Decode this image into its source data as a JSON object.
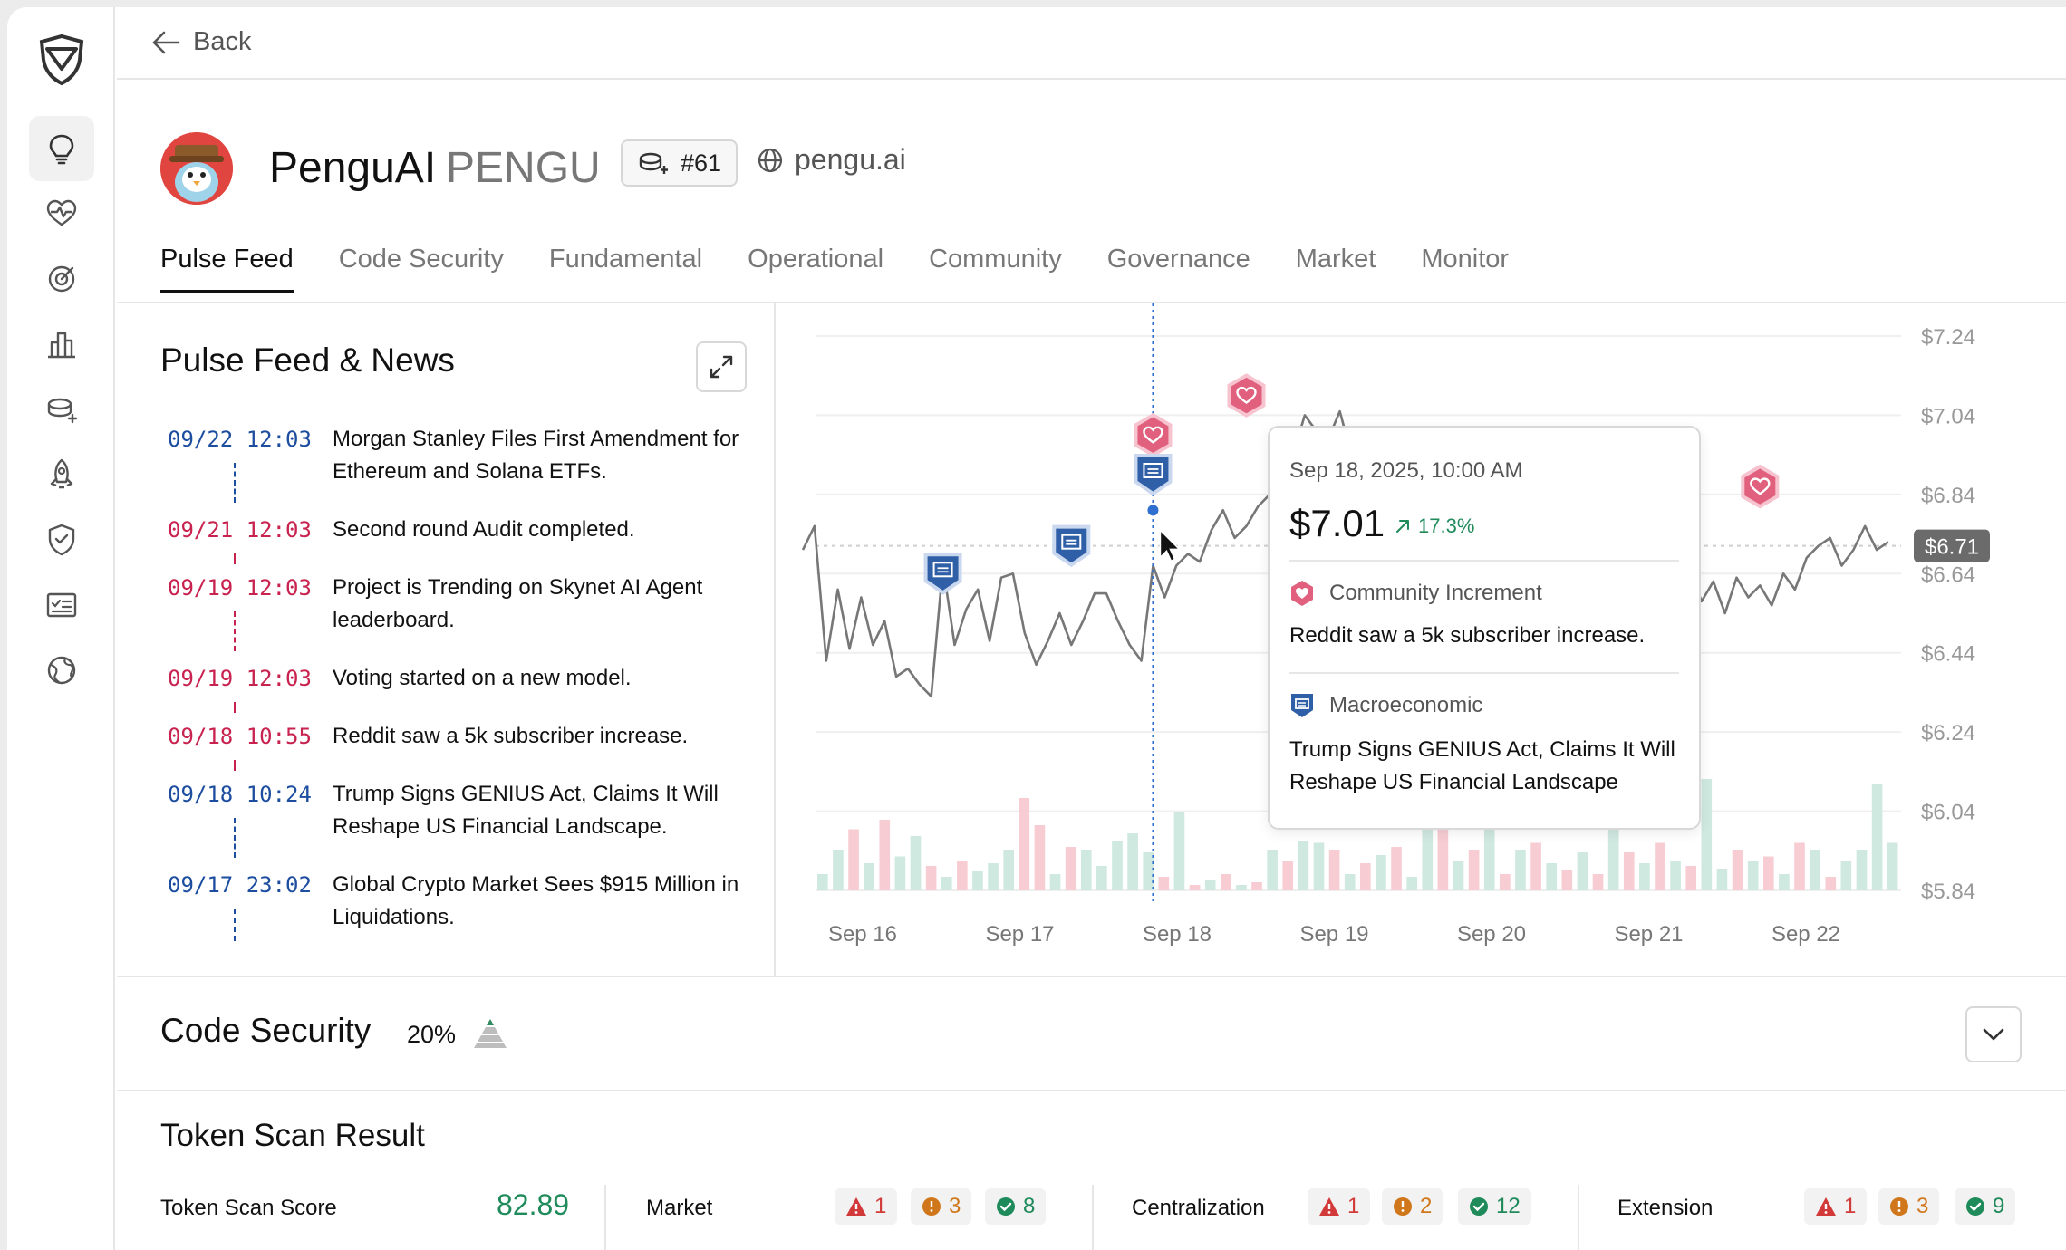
{
  "topbar": {
    "back_label": "Back"
  },
  "project": {
    "name": "PenguAI",
    "ticker": "PENGU",
    "rank": "#61",
    "website": "pengu.ai"
  },
  "tabs": [
    {
      "label": "Pulse Feed",
      "active": true
    },
    {
      "label": "Code Security"
    },
    {
      "label": "Fundamental"
    },
    {
      "label": "Operational"
    },
    {
      "label": "Community"
    },
    {
      "label": "Governance"
    },
    {
      "label": "Market"
    },
    {
      "label": "Monitor"
    }
  ],
  "feed": {
    "title": "Pulse Feed & News",
    "items": [
      {
        "time": "09/22 12:03",
        "text": "Morgan Stanley Files First Amendment for Ethereum and Solana ETFs.",
        "tone": "blue"
      },
      {
        "time": "09/21 12:03",
        "text": "Second round Audit completed.",
        "tone": "red"
      },
      {
        "time": "09/19 12:03",
        "text": "Project is Trending on Skynet AI Agent leaderboard.",
        "tone": "red"
      },
      {
        "time": "09/19 12:03",
        "text": "Voting started on a new model.",
        "tone": "red"
      },
      {
        "time": "09/18 10:55",
        "text": "Reddit saw a 5k subscriber increase.",
        "tone": "red"
      },
      {
        "time": "09/18 10:24",
        "text": "Trump Signs GENIUS Act, Claims It Will Reshape US Financial Landscape.",
        "tone": "blue"
      },
      {
        "time": "09/17 23:02",
        "text": "Global Crypto Market Sees $915 Million in Liquidations.",
        "tone": "blue"
      }
    ]
  },
  "chart_data": {
    "type": "line",
    "x_ticks": [
      "Sep 16",
      "Sep 17",
      "Sep 18",
      "Sep 19",
      "Sep 20",
      "Sep 21",
      "Sep 22"
    ],
    "y_ticks": [
      "$7.24",
      "$7.04",
      "$6.84",
      "$6.64",
      "$6.44",
      "$6.24",
      "$6.04",
      "$5.84"
    ],
    "ylim": [
      5.84,
      7.24
    ],
    "current_price_label": "$6.71",
    "current_price": 6.71,
    "series": [
      {
        "values": [
          6.7,
          6.76,
          6.42,
          6.6,
          6.45,
          6.58,
          6.46,
          6.52,
          6.38,
          6.4,
          6.36,
          6.33,
          6.66,
          6.46,
          6.55,
          6.6,
          6.47,
          6.63,
          6.64,
          6.49,
          6.41,
          6.47,
          6.54,
          6.46,
          6.52,
          6.59,
          6.59,
          6.52,
          6.46,
          6.42,
          6.66,
          6.58,
          6.66,
          6.69,
          6.67,
          6.75,
          6.8,
          6.73,
          6.76,
          6.81,
          6.84,
          6.9,
          6.94,
          7.04,
          7.0,
          6.98,
          7.05,
          6.94,
          6.9,
          6.85,
          6.81,
          6.79,
          6.78,
          6.73,
          6.66,
          6.69,
          6.63,
          6.68,
          6.61,
          6.64,
          6.56,
          6.66,
          6.7,
          6.64,
          6.66,
          6.74,
          6.7,
          6.68,
          6.61,
          6.67,
          6.74,
          6.66,
          6.72,
          6.68,
          6.67,
          6.62,
          6.65,
          6.57,
          6.62,
          6.54,
          6.63,
          6.58,
          6.61,
          6.56,
          6.64,
          6.6,
          6.68,
          6.71,
          6.73,
          6.66,
          6.7,
          6.76,
          6.7,
          6.72
        ]
      }
    ],
    "volume": [
      {
        "v": 0.12,
        "up": true
      },
      {
        "v": 0.3,
        "up": true
      },
      {
        "v": 0.45,
        "up": false
      },
      {
        "v": 0.2,
        "up": true
      },
      {
        "v": 0.52,
        "up": false
      },
      {
        "v": 0.25,
        "up": true
      },
      {
        "v": 0.4,
        "up": true
      },
      {
        "v": 0.18,
        "up": false
      },
      {
        "v": 0.1,
        "up": true
      },
      {
        "v": 0.22,
        "up": false
      },
      {
        "v": 0.14,
        "up": true
      },
      {
        "v": 0.2,
        "up": true
      },
      {
        "v": 0.3,
        "up": true
      },
      {
        "v": 0.68,
        "up": false
      },
      {
        "v": 0.48,
        "up": false
      },
      {
        "v": 0.12,
        "up": true
      },
      {
        "v": 0.32,
        "up": false
      },
      {
        "v": 0.3,
        "up": true
      },
      {
        "v": 0.18,
        "up": true
      },
      {
        "v": 0.36,
        "up": true
      },
      {
        "v": 0.42,
        "up": true
      },
      {
        "v": 0.28,
        "up": true
      },
      {
        "v": 0.1,
        "up": false
      },
      {
        "v": 0.58,
        "up": true
      },
      {
        "v": 0.04,
        "up": false
      },
      {
        "v": 0.08,
        "up": true
      },
      {
        "v": 0.12,
        "up": false
      },
      {
        "v": 0.04,
        "up": true
      },
      {
        "v": 0.06,
        "up": false
      },
      {
        "v": 0.3,
        "up": true
      },
      {
        "v": 0.22,
        "up": false
      },
      {
        "v": 0.36,
        "up": true
      },
      {
        "v": 0.35,
        "up": true
      },
      {
        "v": 0.3,
        "up": false
      },
      {
        "v": 0.12,
        "up": true
      },
      {
        "v": 0.2,
        "up": false
      },
      {
        "v": 0.26,
        "up": true
      },
      {
        "v": 0.32,
        "up": false
      },
      {
        "v": 0.1,
        "up": true
      },
      {
        "v": 0.6,
        "up": true
      },
      {
        "v": 0.45,
        "up": false
      },
      {
        "v": 0.22,
        "up": true
      },
      {
        "v": 0.3,
        "up": false
      },
      {
        "v": 0.55,
        "up": true
      },
      {
        "v": 0.12,
        "up": false
      },
      {
        "v": 0.3,
        "up": true
      },
      {
        "v": 0.35,
        "up": false
      },
      {
        "v": 0.2,
        "up": true
      },
      {
        "v": 0.15,
        "up": false
      },
      {
        "v": 0.28,
        "up": true
      },
      {
        "v": 0.12,
        "up": false
      },
      {
        "v": 0.45,
        "up": true
      },
      {
        "v": 0.28,
        "up": false
      },
      {
        "v": 0.2,
        "up": true
      },
      {
        "v": 0.35,
        "up": false
      },
      {
        "v": 0.22,
        "up": true
      },
      {
        "v": 0.18,
        "up": false
      },
      {
        "v": 0.82,
        "up": true
      },
      {
        "v": 0.16,
        "up": true
      },
      {
        "v": 0.3,
        "up": false
      },
      {
        "v": 0.22,
        "up": true
      },
      {
        "v": 0.25,
        "up": false
      },
      {
        "v": 0.12,
        "up": true
      },
      {
        "v": 0.35,
        "up": false
      },
      {
        "v": 0.3,
        "up": true
      },
      {
        "v": 0.1,
        "up": false
      },
      {
        "v": 0.22,
        "up": true
      },
      {
        "v": 0.3,
        "up": true
      },
      {
        "v": 0.78,
        "up": true
      },
      {
        "v": 0.35,
        "up": true
      }
    ],
    "events": [
      {
        "kind": "news",
        "x_index": 12,
        "y": 6.64
      },
      {
        "kind": "news",
        "x_index": 23,
        "y": 6.71
      },
      {
        "kind": "community",
        "x_index": 30,
        "y": 6.99
      },
      {
        "kind": "news",
        "x_index": 30,
        "y": 6.89
      },
      {
        "kind": "community",
        "x_index": 38,
        "y": 7.09
      },
      {
        "kind": "news",
        "x_index": 66,
        "y": 6.72
      },
      {
        "kind": "community",
        "x_index": 82,
        "y": 6.86
      }
    ],
    "hover_index": 30,
    "hover_value": 6.8
  },
  "tooltip": {
    "date": "Sep 18, 2025, 10:00 AM",
    "price": "$7.01",
    "change": "17.3%",
    "events": [
      {
        "category": "Community Increment",
        "description": "Reddit saw a 5k subscriber increase.",
        "icon": "heart-hex-icon"
      },
      {
        "category": "Macroeconomic",
        "description": "Trump Signs GENIUS Act, Claims It Will Reshape US Financial Landscape",
        "icon": "news-shield-icon"
      }
    ]
  },
  "code_security": {
    "title": "Code Security",
    "percent": "20%"
  },
  "token_scan": {
    "title": "Token Scan Result",
    "score_label": "Token Scan Score",
    "score": "82.89",
    "groups": [
      {
        "label": "Market",
        "critical": "1",
        "warning": "3",
        "ok": "8"
      },
      {
        "label": "Centralization",
        "critical": "1",
        "warning": "2",
        "ok": "12"
      },
      {
        "label": "Extension",
        "critical": "1",
        "warning": "3",
        "ok": "9"
      }
    ]
  },
  "colors": {
    "blue": "#1d4d9f",
    "red": "#c8224f",
    "green": "#1f8a5a",
    "up_bar": "#cfe8e0",
    "down_bar": "#f7cdd3",
    "line": "#777777"
  }
}
